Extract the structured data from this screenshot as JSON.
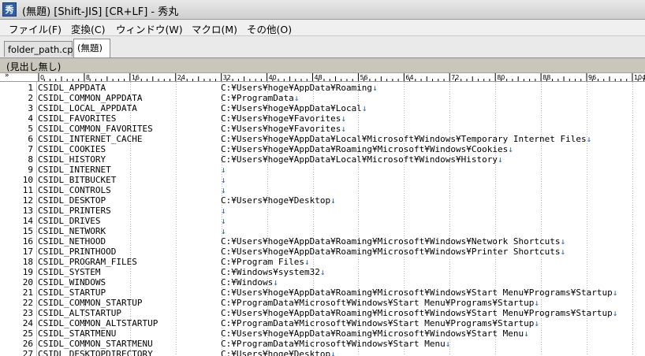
{
  "window": {
    "title": "(無題) [Shift-JIS] [CR+LF] - 秀丸",
    "icon_glyph": "秀"
  },
  "menu": [
    {
      "label": "ファイル(F)"
    },
    {
      "label": "変換(C)"
    },
    {
      "label": "ウィンドウ(W)"
    },
    {
      "label": "マクロ(M)"
    },
    {
      "label": "その他(O)"
    }
  ],
  "tabs": [
    {
      "label": "folder_path.cpp",
      "active": false
    },
    {
      "label": "(無題)",
      "active": true
    }
  ],
  "infobar": {
    "text": "(見出し無し)"
  },
  "ruler": {
    "arrow": "»",
    "labels": [
      "0",
      "8",
      "16",
      "24",
      "32",
      "40",
      "48",
      "56",
      "64",
      "72",
      "80",
      "88",
      "96",
      "104"
    ]
  },
  "newline_glyph": "↓",
  "lines": [
    {
      "n": "1",
      "csidl": "CSIDL_APPDATA",
      "path": "C:¥Users¥hoge¥AppData¥Roaming"
    },
    {
      "n": "2",
      "csidl": "CSIDL_COMMON_APPDATA",
      "path": "C:¥ProgramData"
    },
    {
      "n": "3",
      "csidl": "CSIDL_LOCAL_APPDATA",
      "path": "C:¥Users¥hoge¥AppData¥Local"
    },
    {
      "n": "4",
      "csidl": "CSIDL_FAVORITES",
      "path": "C:¥Users¥hoge¥Favorites"
    },
    {
      "n": "5",
      "csidl": "CSIDL_COMMON_FAVORITES",
      "path": "C:¥Users¥hoge¥Favorites"
    },
    {
      "n": "6",
      "csidl": "CSIDL_INTERNET_CACHE",
      "path": "C:¥Users¥hoge¥AppData¥Local¥Microsoft¥Windows¥Temporary Internet Files"
    },
    {
      "n": "7",
      "csidl": "CSIDL_COOKIES",
      "path": "C:¥Users¥hoge¥AppData¥Roaming¥Microsoft¥Windows¥Cookies"
    },
    {
      "n": "8",
      "csidl": "CSIDL_HISTORY",
      "path": "C:¥Users¥hoge¥AppData¥Local¥Microsoft¥Windows¥History"
    },
    {
      "n": "9",
      "csidl": "CSIDL_INTERNET",
      "path": ""
    },
    {
      "n": "10",
      "csidl": "CSIDL_BITBUCKET",
      "path": ""
    },
    {
      "n": "11",
      "csidl": "CSIDL_CONTROLS",
      "path": ""
    },
    {
      "n": "12",
      "csidl": "CSIDL_DESKTOP",
      "path": "C:¥Users¥hoge¥Desktop"
    },
    {
      "n": "13",
      "csidl": "CSIDL_PRINTERS",
      "path": ""
    },
    {
      "n": "14",
      "csidl": "CSIDL_DRIVES",
      "path": ""
    },
    {
      "n": "15",
      "csidl": "CSIDL_NETWORK",
      "path": ""
    },
    {
      "n": "16",
      "csidl": "CSIDL_NETHOOD",
      "path": "C:¥Users¥hoge¥AppData¥Roaming¥Microsoft¥Windows¥Network Shortcuts"
    },
    {
      "n": "17",
      "csidl": "CSIDL_PRINTHOOD",
      "path": "C:¥Users¥hoge¥AppData¥Roaming¥Microsoft¥Windows¥Printer Shortcuts"
    },
    {
      "n": "18",
      "csidl": "CSIDL_PROGRAM_FILES",
      "path": "C:¥Program Files"
    },
    {
      "n": "19",
      "csidl": "CSIDL_SYSTEM",
      "path": "C:¥Windows¥system32"
    },
    {
      "n": "20",
      "csidl": "CSIDL_WINDOWS",
      "path": "C:¥Windows"
    },
    {
      "n": "21",
      "csidl": "CSIDL_STARTUP",
      "path": "C:¥Users¥hoge¥AppData¥Roaming¥Microsoft¥Windows¥Start Menu¥Programs¥Startup"
    },
    {
      "n": "22",
      "csidl": "CSIDL_COMMON_STARTUP",
      "path": "C:¥ProgramData¥Microsoft¥Windows¥Start Menu¥Programs¥Startup"
    },
    {
      "n": "23",
      "csidl": "CSIDL_ALTSTARTUP",
      "path": "C:¥Users¥hoge¥AppData¥Roaming¥Microsoft¥Windows¥Start Menu¥Programs¥Startup"
    },
    {
      "n": "24",
      "csidl": "CSIDL_COMMON_ALTSTARTUP",
      "path": "C:¥ProgramData¥Microsoft¥Windows¥Start Menu¥Programs¥Startup"
    },
    {
      "n": "25",
      "csidl": "CSIDL_STARTMENU",
      "path": "C:¥Users¥hoge¥AppData¥Roaming¥Microsoft¥Windows¥Start Menu"
    },
    {
      "n": "26",
      "csidl": "CSIDL_COMMON_STARTMENU",
      "path": "C:¥ProgramData¥Microsoft¥Windows¥Start Menu"
    },
    {
      "n": "27",
      "csidl": "CSIDL_DESKTOPDIRECTORY",
      "path": "C:¥Users¥hoge¥Desktop"
    }
  ]
}
